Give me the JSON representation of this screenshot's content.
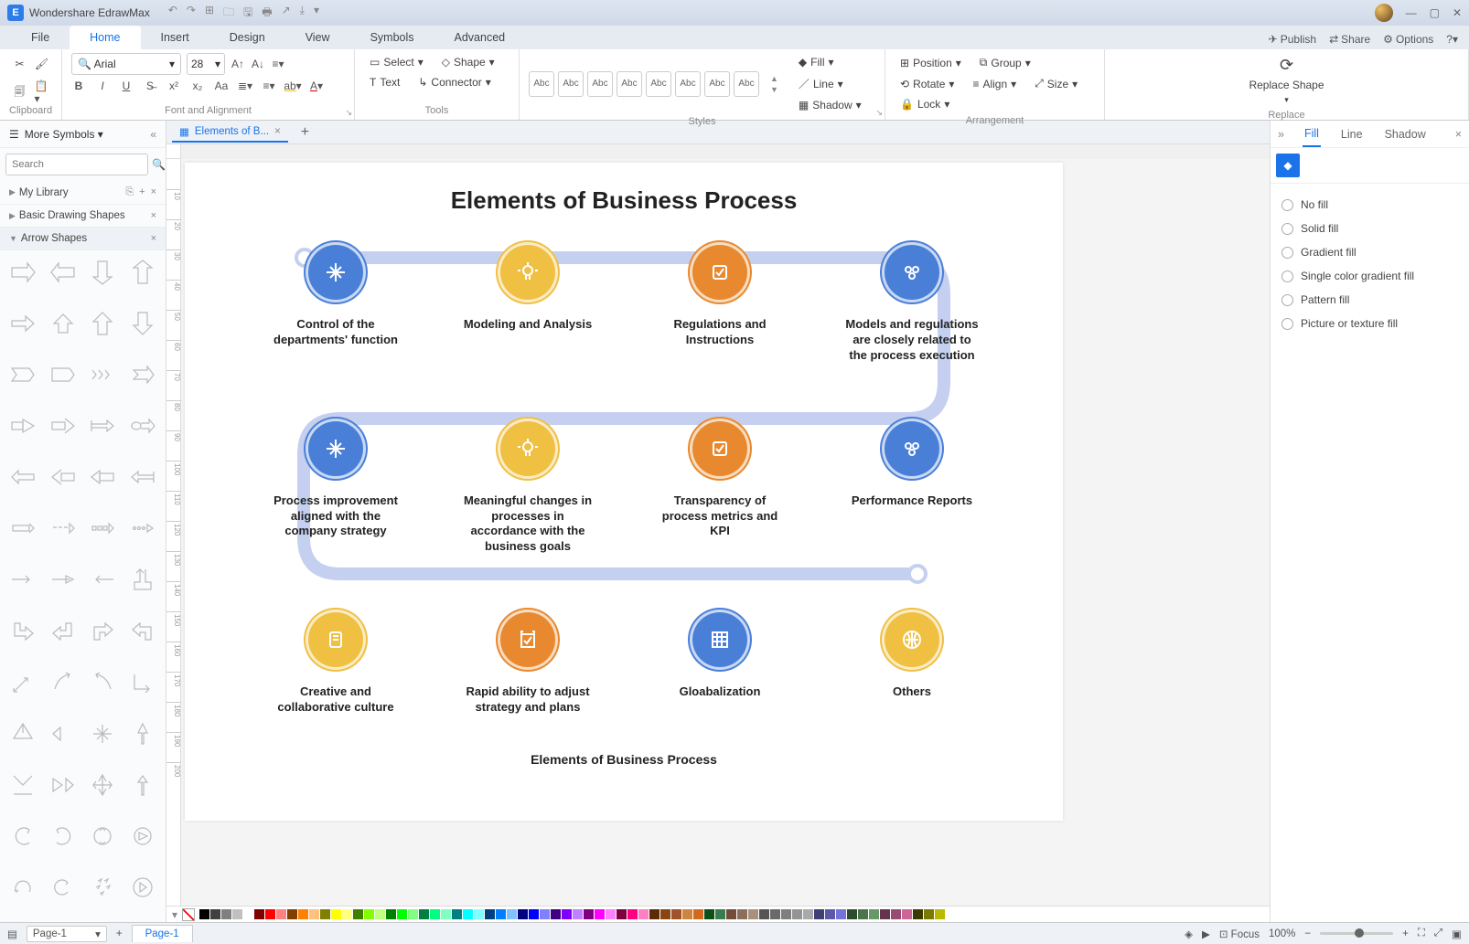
{
  "app": {
    "name": "Wondershare EdrawMax"
  },
  "window_controls": {
    "min": "—",
    "max": "▢",
    "close": "✕"
  },
  "menu": {
    "tabs": [
      "File",
      "Home",
      "Insert",
      "Design",
      "View",
      "Symbols",
      "Advanced"
    ],
    "active": "Home",
    "right": {
      "publish": "Publish",
      "share": "Share",
      "options": "Options"
    }
  },
  "ribbon": {
    "clipboard": {
      "label": "Clipboard"
    },
    "font": {
      "label": "Font and Alignment",
      "family": "Arial",
      "size": "28"
    },
    "tools": {
      "label": "Tools",
      "select": "Select",
      "shape": "Shape",
      "text": "Text",
      "connector": "Connector"
    },
    "styles": {
      "label": "Styles",
      "swatch_text": "Abc",
      "fill": "Fill",
      "line": "Line",
      "shadow": "Shadow"
    },
    "arrangement": {
      "label": "Arrangement",
      "position": "Position",
      "group": "Group",
      "rotate": "Rotate",
      "align": "Align",
      "size": "Size",
      "lock": "Lock"
    },
    "replace": {
      "label": "Replace",
      "replace_shape": "Replace Shape"
    }
  },
  "left_panel": {
    "title": "More Symbols",
    "search_placeholder": "Search",
    "libs": {
      "my_library": "My Library",
      "basic": "Basic Drawing Shapes",
      "arrow": "Arrow Shapes"
    }
  },
  "doc": {
    "tab_name": "Elements of B...",
    "title": "Elements of Business Process",
    "caption": "Elements of Business Process",
    "row1": [
      {
        "color": "blue",
        "label": "Control of the departments' function"
      },
      {
        "color": "yellow",
        "label": "Modeling and Analysis"
      },
      {
        "color": "orange",
        "label": "Regulations and Instructions"
      },
      {
        "color": "blue",
        "label": "Models and regulations are closely related to the process execution"
      }
    ],
    "row2": [
      {
        "color": "blue",
        "label": "Process improvement aligned with the company strategy"
      },
      {
        "color": "yellow",
        "label": "Meaningful changes in processes in accordance with the business goals"
      },
      {
        "color": "orange",
        "label": "Transparency of process metrics and KPI"
      },
      {
        "color": "blue",
        "label": "Performance Reports"
      }
    ],
    "row3": [
      {
        "color": "yellow",
        "label": "Creative and collaborative culture"
      },
      {
        "color": "orange",
        "label": "Rapid ability to adjust strategy and plans"
      },
      {
        "color": "blue",
        "label": "Gloabalization"
      },
      {
        "color": "yellow",
        "label": "Others"
      }
    ]
  },
  "right_panel": {
    "tabs": {
      "fill": "Fill",
      "line": "Line",
      "shadow": "Shadow"
    },
    "options": {
      "no_fill": "No fill",
      "solid": "Solid fill",
      "gradient": "Gradient fill",
      "single_gradient": "Single color gradient fill",
      "pattern": "Pattern fill",
      "picture": "Picture or texture fill"
    }
  },
  "status": {
    "page_selector": "Page-1",
    "page_tab": "Page-1",
    "focus": "Focus",
    "zoom": "100%"
  },
  "colorbar": [
    "#000000",
    "#404040",
    "#808080",
    "#c0c0c0",
    "#ffffff",
    "#800000",
    "#ff0000",
    "#ff8080",
    "#804000",
    "#ff8000",
    "#ffc080",
    "#808000",
    "#ffff00",
    "#ffff80",
    "#408000",
    "#80ff00",
    "#c0ff80",
    "#008000",
    "#00ff00",
    "#80ff80",
    "#008040",
    "#00ff80",
    "#80ffc0",
    "#008080",
    "#00ffff",
    "#80ffff",
    "#004080",
    "#0080ff",
    "#80c0ff",
    "#000080",
    "#0000ff",
    "#8080ff",
    "#400080",
    "#8000ff",
    "#c080ff",
    "#800080",
    "#ff00ff",
    "#ff80ff",
    "#800040",
    "#ff0080",
    "#ff80c0",
    "#5b2c06",
    "#8b4513",
    "#a0522d",
    "#cd853f",
    "#d2691e",
    "#0d5016",
    "#3a7c4f",
    "#724b3b",
    "#8b6f5c",
    "#a8907d",
    "#555555",
    "#6a6a6a",
    "#7f7f7f",
    "#949494",
    "#a9a9a9",
    "#3f3f76",
    "#5959a8",
    "#7373da",
    "#2f4b2f",
    "#4a754a",
    "#669966",
    "#66334c",
    "#994c72",
    "#cc6699",
    "#3a3a00",
    "#7a7a00",
    "#baba00"
  ]
}
